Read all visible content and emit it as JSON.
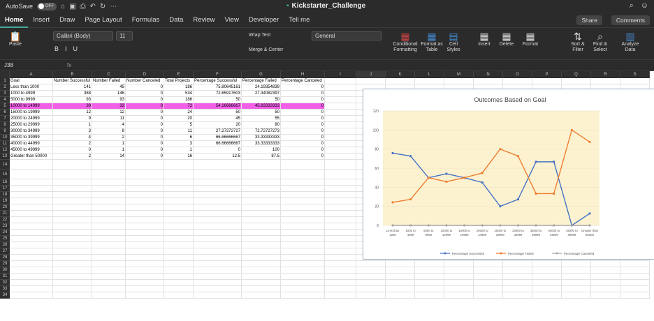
{
  "titlebar": {
    "autosave": "AutoSave",
    "toggle": "OFF",
    "doc": "Kickstarter_Challenge"
  },
  "tabs": [
    "Home",
    "Insert",
    "Draw",
    "Page Layout",
    "Formulas",
    "Data",
    "Review",
    "View",
    "Developer",
    "Tell me"
  ],
  "share": "Share",
  "comments": "Comments",
  "ribbon": {
    "paste": "Paste",
    "font": "Calibri (Body)",
    "size": "11",
    "wrap": "Wrap Text",
    "merge": "Merge & Center",
    "numfmt": "General",
    "cond": "Conditional Formatting",
    "fmt_table": "Format as Table",
    "cell_styles": "Cell Styles",
    "insert": "Insert",
    "delete": "Delete",
    "format": "Format",
    "sort": "Sort & Filter",
    "find": "Find & Select",
    "analyze": "Analyze Data"
  },
  "namebox": "J38",
  "fx": "fx",
  "columns": [
    "A",
    "B",
    "C",
    "D",
    "E",
    "F",
    "G",
    "H",
    "I",
    "J",
    "K",
    "L",
    "M",
    "N",
    "O",
    "P",
    "Q",
    "R",
    "S"
  ],
  "rows": [
    "1",
    "2",
    "3",
    "4",
    "5",
    "6",
    "7",
    "8",
    "9",
    "10",
    "11",
    "12",
    "13",
    "14",
    "15",
    "16",
    "17",
    "18",
    "19",
    "20",
    "21",
    "22",
    "23",
    "24",
    "25",
    "26",
    "27",
    "28",
    "29",
    "30",
    "31",
    "32",
    "33",
    "34"
  ],
  "headers": [
    "Goal",
    "Number Successful",
    "Number Failed",
    "Number Canceled",
    "Total Projects",
    "Percentage Successful",
    "Percentage Failed",
    "Percentage Canceled"
  ],
  "table": [
    [
      "Less than 1000",
      "141",
      "45",
      "0",
      "186",
      "75.80645161",
      "24.19354839",
      "0"
    ],
    [
      "1000 to 4999",
      "388",
      "146",
      "0",
      "534",
      "72.65917603",
      "27.34082397",
      "0"
    ],
    [
      "5000 to 9999",
      "93",
      "93",
      "0",
      "186",
      "50",
      "50",
      "0"
    ],
    [
      "10000 to 14999",
      "39",
      "33",
      "0",
      "72",
      "54.16666667",
      "45.83333333",
      "0"
    ],
    [
      "15000 to 19999",
      "12",
      "12",
      "0",
      "24",
      "50",
      "50",
      "0"
    ],
    [
      "20000 to 24999",
      "9",
      "11",
      "0",
      "20",
      "45",
      "55",
      "0"
    ],
    [
      "25000 to 29999",
      "1",
      "4",
      "0",
      "5",
      "20",
      "80",
      "0"
    ],
    [
      "30000 to 34999",
      "3",
      "8",
      "0",
      "11",
      "27.27272727",
      "72.72727273",
      "0"
    ],
    [
      "35000 to 39999",
      "4",
      "2",
      "0",
      "6",
      "66.66666667",
      "33.33333333",
      "0"
    ],
    [
      "40000 to 44999",
      "2",
      "1",
      "0",
      "3",
      "66.66666667",
      "33.33333333",
      "0"
    ],
    [
      "45000 to 49999",
      "0",
      "1",
      "0",
      "1",
      "0",
      "100",
      "0"
    ],
    [
      "Greater than 50000",
      "2",
      "14",
      "0",
      "16",
      "12.5",
      "87.5",
      "0"
    ]
  ],
  "chart_data": {
    "type": "line",
    "title": "Outcomes Based on Goal",
    "categories": [
      "Less than 1000",
      "1000 to 4999",
      "5000 to 9999",
      "10000 to 14999",
      "15000 to 19999",
      "20000 to 24999",
      "25000 to 29999",
      "30000 to 34999",
      "35000 to 39999",
      "40000 to 44999",
      "45000 to 49999",
      "Greater than 50000"
    ],
    "series": [
      {
        "name": "Percentage Successful",
        "color": "#4472c4",
        "values": [
          75.81,
          72.66,
          50,
          54.17,
          50,
          45,
          20,
          27.27,
          66.67,
          66.67,
          0,
          12.5
        ]
      },
      {
        "name": "Percentage Failed",
        "color": "#ed7d31",
        "values": [
          24.19,
          27.34,
          50,
          45.83,
          50,
          55,
          80,
          72.73,
          33.33,
          33.33,
          100,
          87.5
        ]
      },
      {
        "name": "Percentage Canceled",
        "color": "#a5a5a5",
        "values": [
          0,
          0,
          0,
          0,
          0,
          0,
          0,
          0,
          0,
          0,
          0,
          0
        ]
      }
    ],
    "ylim": [
      0,
      120
    ],
    "yticks": [
      "0",
      "20",
      "40",
      "60",
      "80",
      "100",
      "120"
    ],
    "legend": "bottom",
    "plot_bg": "#fdf2d0"
  }
}
